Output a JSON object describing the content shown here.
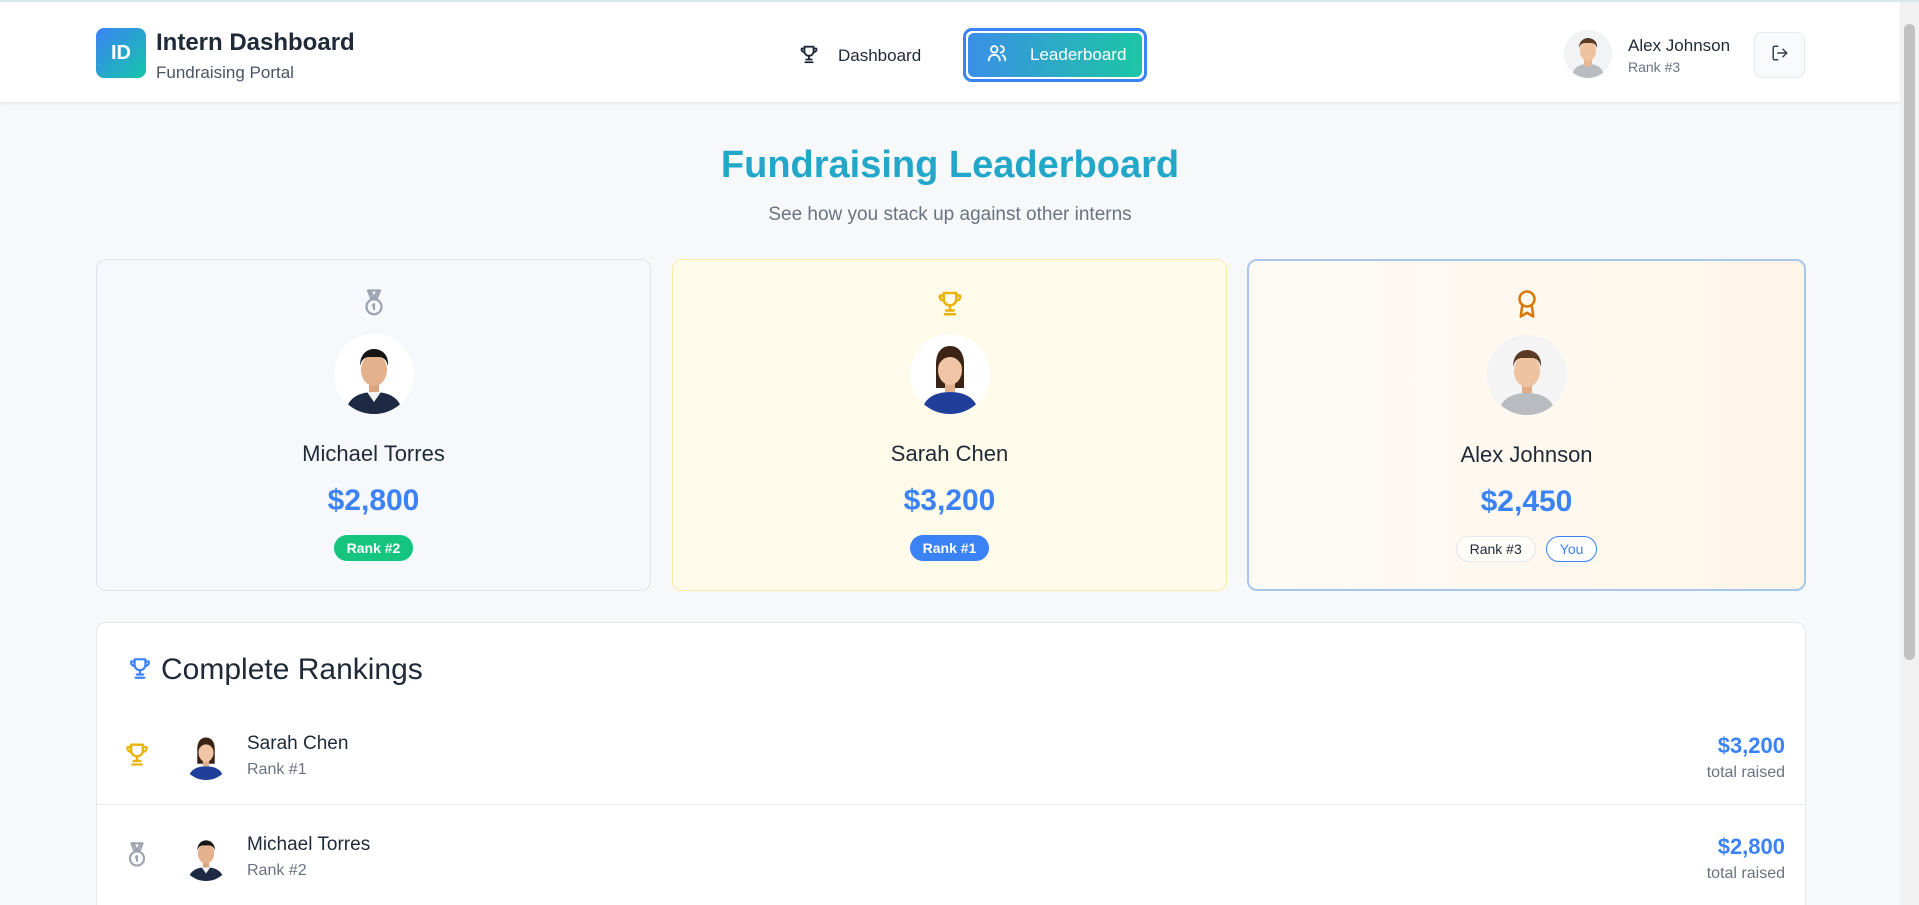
{
  "header": {
    "logo_text": "ID",
    "title": "Intern Dashboard",
    "subtitle": "Fundraising Portal",
    "nav": [
      {
        "label": "Dashboard",
        "icon": "trophy-icon",
        "active": false
      },
      {
        "label": "Leaderboard",
        "icon": "users-icon",
        "active": true
      }
    ],
    "user": {
      "name": "Alex Johnson",
      "rank": "Rank #3"
    },
    "logout_icon": "logout-icon"
  },
  "page": {
    "title": "Fundraising Leaderboard",
    "subtitle": "See how you stack up against other interns"
  },
  "podium": [
    {
      "name": "Michael Torres",
      "amount": "$2,800",
      "rank": "Rank #2",
      "medal": "medal-icon"
    },
    {
      "name": "Sarah Chen",
      "amount": "$3,200",
      "rank": "Rank #1",
      "medal": "trophy-icon"
    },
    {
      "name": "Alex Johnson",
      "amount": "$2,450",
      "rank": "Rank #3",
      "you": "You",
      "medal": "award-icon"
    }
  ],
  "rankings": {
    "title": "Complete Rankings",
    "rows": [
      {
        "name": "Sarah Chen",
        "rank": "Rank #1",
        "amount": "$3,200",
        "sub": "total raised"
      },
      {
        "name": "Michael Torres",
        "rank": "Rank #2",
        "amount": "$2,800",
        "sub": "total raised"
      }
    ]
  },
  "colors": {
    "accent": "#3b82f6",
    "teal": "#14c7a8",
    "title": "#22a7c8",
    "gold": "#eab308",
    "bronze": "#d97706",
    "green": "#14c47f"
  }
}
